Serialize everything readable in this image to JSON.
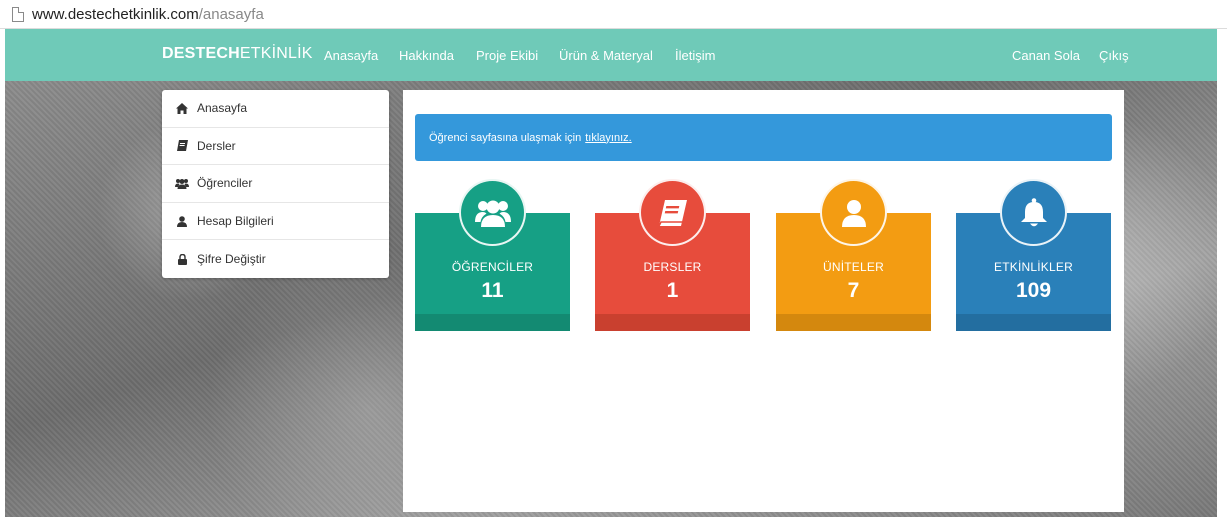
{
  "browser": {
    "url_host": "www.destechetkinlik.com",
    "url_path": "/anasayfa"
  },
  "navbar": {
    "brand_bold": "DESTECH",
    "brand_light": "ETKİNLİK",
    "links": [
      "Anasayfa",
      "Hakkında",
      "Proje Ekibi",
      "Ürün & Materyal",
      "İletişim"
    ],
    "user": "Canan Sola",
    "logout": "Çıkış",
    "color": "#6fcab8"
  },
  "sidebar": {
    "items": [
      {
        "label": "Anasayfa",
        "icon": "home-icon"
      },
      {
        "label": "Dersler",
        "icon": "book-icon"
      },
      {
        "label": "Öğrenciler",
        "icon": "users-icon"
      },
      {
        "label": "Hesap Bilgileri",
        "icon": "user-icon"
      },
      {
        "label": "Şifre Değiştir",
        "icon": "lock-icon"
      }
    ]
  },
  "alert": {
    "text": "Öğrenci sayfasına ulaşmak için",
    "link": "tıklayınız.",
    "color": "#3498db"
  },
  "stats": [
    {
      "label": "ÖĞRENCİLER",
      "value": "11",
      "icon": "users-icon",
      "color": "#16a085",
      "dark": "#138a72"
    },
    {
      "label": "DERSLER",
      "value": "1",
      "icon": "book-icon",
      "color": "#e74c3c",
      "dark": "#c9402f"
    },
    {
      "label": "ÜNİTELER",
      "value": "7",
      "icon": "user-icon",
      "color": "#f39c12",
      "dark": "#d4880e"
    },
    {
      "label": "ETKİNLİKLER",
      "value": "109",
      "icon": "bell-icon",
      "color": "#2a80b9",
      "dark": "#236ea0"
    }
  ]
}
